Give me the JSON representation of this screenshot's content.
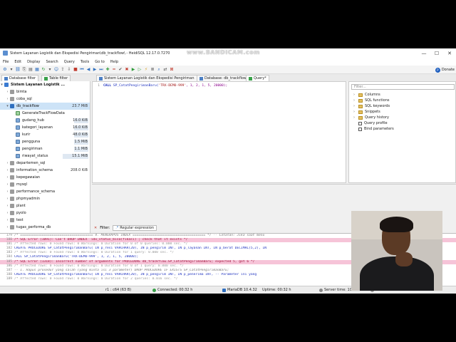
{
  "window": {
    "title": "Sistem Layanan Logistik dan Ekspedisi Pengiriman\\db_trackflow\\ - HeidiSQL 12.17.0.7270",
    "watermark": "www.BANDICAM.com",
    "controls": [
      "—",
      "☐",
      "✕"
    ]
  },
  "menu": [
    "File",
    "Edit",
    "Display",
    "Search",
    "Query",
    "Tools",
    "Go to",
    "Help"
  ],
  "toolbar": {
    "donate_label": "Donate"
  },
  "tabs": {
    "left": [
      "Database filter",
      "Table filter"
    ],
    "right": [
      "Sistem Layanan Logistik dan Ekspedisi Pengiriman",
      "Database: db_trackflow",
      "Query*"
    ]
  },
  "tree": {
    "root": "Sistem Layanan Logistik ...",
    "items": [
      {
        "label": "bimta",
        "size": "",
        "icon": "database-icon"
      },
      {
        "label": "coba_sql",
        "size": "",
        "icon": "database-icon"
      },
      {
        "label": "db_trackflow",
        "size": "23.7 MiB",
        "icon": "database-icon",
        "selected": true
      },
      {
        "label": "GenerateTrackFlowData",
        "size": "",
        "icon": "procedure-icon"
      },
      {
        "label": "gudang_hub",
        "size": "16.0 KiB",
        "icon": "table-icon"
      },
      {
        "label": "kategori_layanan",
        "size": "16.0 KiB",
        "icon": "table-icon"
      },
      {
        "label": "kurir",
        "size": "48.0 KiB",
        "icon": "table-icon"
      },
      {
        "label": "pengguna",
        "size": "1.5 MiB",
        "icon": "table-icon"
      },
      {
        "label": "pengiriman",
        "size": "1.1 MiB",
        "icon": "table-icon"
      },
      {
        "label": "riwayat_status",
        "size": "15.1 MiB",
        "icon": "table-icon"
      },
      {
        "label": "departemen_sql",
        "size": "",
        "icon": "database-icon"
      },
      {
        "label": "information_schema",
        "size": "208.0 KiB",
        "icon": "database-icon"
      },
      {
        "label": "kepegawaian",
        "size": "",
        "icon": "database-icon"
      },
      {
        "label": "mysql",
        "size": "",
        "icon": "database-icon"
      },
      {
        "label": "performance_schema",
        "size": "",
        "icon": "database-icon"
      },
      {
        "label": "phpmyadmin",
        "size": "",
        "icon": "database-icon"
      },
      {
        "label": "plant",
        "size": "",
        "icon": "database-icon"
      },
      {
        "label": "pyolo",
        "size": "",
        "icon": "database-icon"
      },
      {
        "label": "test",
        "size": "",
        "icon": "database-icon"
      },
      {
        "label": "tugas_performa_db",
        "size": "",
        "icon": "database-icon"
      }
    ]
  },
  "editor": {
    "line_number": "1",
    "call_kw": "CALL",
    "proc_name": "SP_CatatPengirimanBaru(",
    "arg_str": "'TRX-DEMO-999'",
    "arg_rest": ", 1, 2, 1, 5, 20000);"
  },
  "helpers": {
    "filter_placeholder": "Filter...",
    "items": [
      "Columns",
      "SQL functions",
      "SQL keywords",
      "Snippets",
      "Query history",
      "Query profile",
      "Bind parameters"
    ]
  },
  "filter_bar": {
    "label": "Filter:",
    "regex_label": "Regular expression"
  },
  "log": [
    {
      "n": "179",
      "t": "/* ===================================== 4. MENGHAPUS INDEX ===================================== */   -- Catatan: Jika saat menu",
      "k": "cmt"
    },
    {
      "n": "180",
      "t": "/* SQL Error (1091): Can't DROP INDEX `idx_status_bisa(fikasi)`; check that it exists */",
      "k": "err"
    },
    {
      "n": "181",
      "t": "/* Affected rows: 0  Found rows: 0  Warnings: 0  Duration for 0 of 0 queries: 0.000 sec. */",
      "k": "muted"
    },
    {
      "n": "182",
      "t": "CREATE PROCEDURE SP_CatatPengirimanBaru(     IN p_resi VARCHAR(20),     IN p_pengirim INT,     IN p_layanan INT,     IN p_berat DECIMAL(5,2),  IN",
      "k": ""
    },
    {
      "n": "183",
      "t": "/* Affected rows: 0  Found rows: 0  Warnings: 0  Duration for 1 query: 0.000 sec. */",
      "k": "muted"
    },
    {
      "n": "184",
      "t": "CALL SP_CatatPengirimanBaru('TRX-DEMO-999', 1, 2, 1, 5, 20000);",
      "k": ""
    },
    {
      "n": "185",
      "t": "/* SQL Error (1318): Incorrect number of arguments for PROCEDURE db_trackflow.SP_CatatPengirimanBaru; expected 5, got 6 */",
      "k": "err"
    },
    {
      "n": "186",
      "t": "/* Affected rows: 0  Found rows: 0  Warnings: 0  Duration for 0 of 1 query: 0.000 sec. */",
      "k": "muted"
    },
    {
      "n": "187",
      "t": "-- 1. Hapus prosedur yang salah (yang minta isi 3 parameter)   DROP PROCEDURE IF EXISTS SP_CatatPengirimanBaru;",
      "k": "cmt"
    },
    {
      "n": "188",
      "t": "CREATE PROCEDURE SP_CatatPengirimanBaru(     IN p_resi VARCHAR(20),     IN p_pengirim INT,     IN p_penerima INT,     -- Parameter ini yang",
      "k": ""
    },
    {
      "n": "189",
      "t": "/* Affected rows: 0  Found rows: 0  Warnings: 0  Duration for 2 queries: 0.016 sec. */",
      "k": "muted"
    }
  ],
  "status": {
    "cursor": "r1 : c64 (63 B)",
    "connected": "Connected: 00:32 h",
    "server": "MariaDB 10.4.32",
    "uptime": "Uptime: 00:32 h",
    "time": "Server time: 10:29 PM",
    "state": "Idle."
  }
}
